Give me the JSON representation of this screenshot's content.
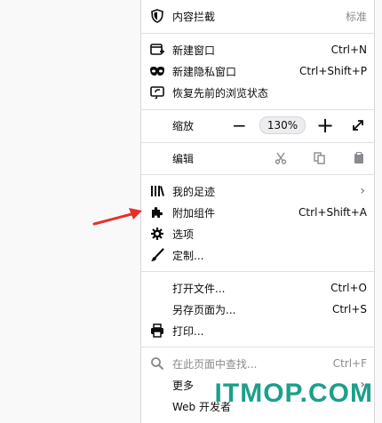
{
  "menu": {
    "tracking": {
      "label": "内容拦截",
      "value": "标准"
    },
    "new_window": {
      "label": "新建窗口",
      "shortcut": "Ctrl+N"
    },
    "private_window": {
      "label": "新建隐私窗口",
      "shortcut": "Ctrl+Shift+P"
    },
    "restore_session": {
      "label": "恢复先前的浏览状态"
    },
    "zoom": {
      "label": "缩放",
      "minus": "−",
      "value": "130%",
      "plus": "+"
    },
    "edit": {
      "label": "编辑"
    },
    "library": {
      "label": "我的足迹"
    },
    "addons": {
      "label": "附加组件",
      "shortcut": "Ctrl+Shift+A"
    },
    "options": {
      "label": "选项"
    },
    "customize": {
      "label": "定制..."
    },
    "open_file": {
      "label": "打开文件...",
      "shortcut": "Ctrl+O"
    },
    "save_page": {
      "label": "另存页面为...",
      "shortcut": "Ctrl+S"
    },
    "print": {
      "label": "打印..."
    },
    "find": {
      "label": "在此页面中查找...",
      "shortcut": "Ctrl+F"
    },
    "more": {
      "label": "更多"
    },
    "web_developer": {
      "label": "Web 开发者"
    }
  },
  "watermark": "ITMOP.COM",
  "colors": {
    "arrow": "#e8302a",
    "watermark": "#1d9f8b"
  }
}
